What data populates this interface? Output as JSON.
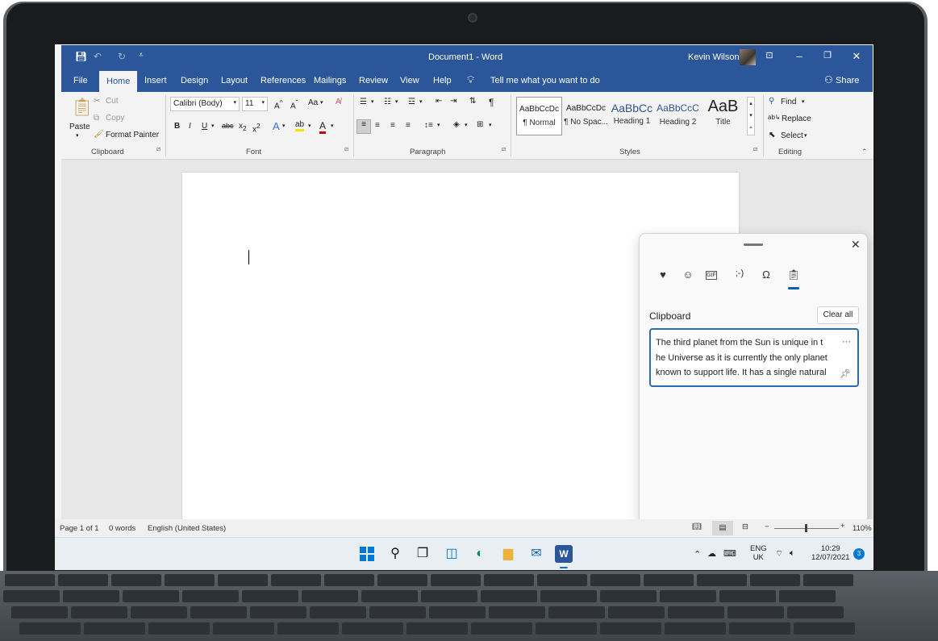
{
  "window": {
    "title": "Document1 - Word",
    "user": "Kevin Wilson"
  },
  "tabs": [
    "File",
    "Home",
    "Insert",
    "Design",
    "Layout",
    "References",
    "Mailings",
    "Review",
    "View",
    "Help"
  ],
  "tell_me": "Tell me what you want to do",
  "share": "Share",
  "ribbon": {
    "clipboard": {
      "paste": "Paste",
      "cut": "Cut",
      "copy": "Copy",
      "format_painter": "Format Painter",
      "label": "Clipboard"
    },
    "font": {
      "name": "Calibri (Body)",
      "size": "11",
      "label": "Font",
      "case": "Aa"
    },
    "paragraph": {
      "label": "Paragraph"
    },
    "styles": {
      "label": "Styles",
      "items": [
        {
          "sample": "AaBbCcDc",
          "name": "¶ Normal"
        },
        {
          "sample": "AaBbCcDc",
          "name": "¶ No Spac..."
        },
        {
          "sample": "AaBbCc",
          "name": "Heading 1"
        },
        {
          "sample": "AaBbCcC",
          "name": "Heading 2"
        },
        {
          "sample": "AaB",
          "name": "Title"
        }
      ]
    },
    "editing": {
      "find": "Find",
      "replace": "Replace",
      "select": "Select",
      "label": "Editing"
    }
  },
  "status": {
    "page": "Page 1 of 1",
    "words": "0 words",
    "language": "English (United States)",
    "zoom": "110%"
  },
  "panel": {
    "section": "Clipboard",
    "clear_all": "Clear all",
    "item_lines": [
      "The third planet from the Sun is unique in t",
      "he Universe as it is currently the only planet",
      "known to support life. It has a single natural"
    ],
    "gif": "GIF",
    "kaomoji": ";-)"
  },
  "tray": {
    "lang1": "ENG",
    "lang2": "UK",
    "time": "10:29",
    "date": "12/07/2021",
    "badge": "3"
  },
  "colors": {
    "word_blue": "#2b579a",
    "accent": "#005fb8"
  }
}
